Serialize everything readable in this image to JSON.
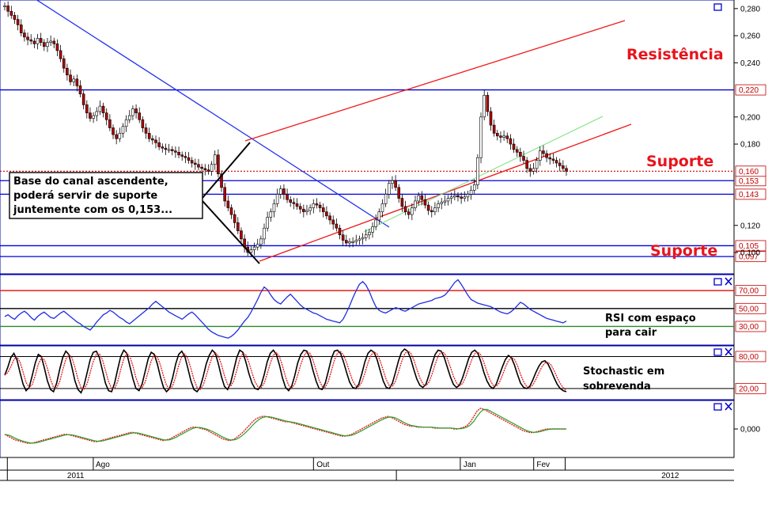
{
  "chart_data": [
    {
      "panel": "price",
      "type": "candlestick",
      "y_ticks": [
        "0,280",
        "0,260",
        "0,240",
        "0,200",
        "0,180",
        "0,120",
        "0,100"
      ],
      "ylim": [
        0.093,
        0.284
      ],
      "support_resistance_levels": [
        {
          "value": 0.22,
          "label": "0,220"
        },
        {
          "value": 0.153,
          "label": "0,153"
        },
        {
          "value": 0.143,
          "label": "0,143"
        },
        {
          "value": 0.105,
          "label": "0,105"
        },
        {
          "value": 0.097,
          "label": "0,097"
        }
      ],
      "last_price": {
        "value": 0.16,
        "label": "0,160"
      },
      "annotations": {
        "resistance": "Resistência",
        "support_1": "Suporte",
        "support_2": "Suporte",
        "note_line1": "Base do canal ascendente,",
        "note_line2": "poderá servir de suporte",
        "note_line3": "juntemente com os 0,153..."
      },
      "close_series": [
        0.282,
        0.278,
        0.275,
        0.272,
        0.268,
        0.262,
        0.259,
        0.257,
        0.256,
        0.254,
        0.258,
        0.255,
        0.252,
        0.255,
        0.256,
        0.254,
        0.249,
        0.243,
        0.236,
        0.231,
        0.226,
        0.228,
        0.223,
        0.217,
        0.209,
        0.203,
        0.199,
        0.201,
        0.204,
        0.208,
        0.203,
        0.198,
        0.192,
        0.187,
        0.184,
        0.188,
        0.193,
        0.198,
        0.201,
        0.206,
        0.203,
        0.198,
        0.192,
        0.188,
        0.184,
        0.183,
        0.181,
        0.178,
        0.177,
        0.176,
        0.176,
        0.175,
        0.174,
        0.172,
        0.171,
        0.17,
        0.168,
        0.166,
        0.165,
        0.163,
        0.162,
        0.161,
        0.16,
        0.165,
        0.172,
        0.158,
        0.148,
        0.138,
        0.133,
        0.128,
        0.122,
        0.116,
        0.11,
        0.104,
        0.1,
        0.102,
        0.104,
        0.106,
        0.11,
        0.118,
        0.126,
        0.13,
        0.136,
        0.143,
        0.147,
        0.143,
        0.139,
        0.137,
        0.136,
        0.134,
        0.132,
        0.13,
        0.131,
        0.133,
        0.136,
        0.135,
        0.133,
        0.13,
        0.127,
        0.124,
        0.121,
        0.118,
        0.113,
        0.109,
        0.107,
        0.108,
        0.108,
        0.109,
        0.11,
        0.111,
        0.113,
        0.115,
        0.119,
        0.124,
        0.13,
        0.136,
        0.143,
        0.151,
        0.153,
        0.148,
        0.14,
        0.134,
        0.13,
        0.128,
        0.133,
        0.138,
        0.142,
        0.139,
        0.135,
        0.131,
        0.13,
        0.133,
        0.136,
        0.137,
        0.138,
        0.14,
        0.141,
        0.142,
        0.141,
        0.14,
        0.141,
        0.143,
        0.146,
        0.15,
        0.17,
        0.2,
        0.216,
        0.204,
        0.194,
        0.188,
        0.186,
        0.185,
        0.186,
        0.184,
        0.18,
        0.176,
        0.174,
        0.171,
        0.168,
        0.162,
        0.16,
        0.162,
        0.168,
        0.175,
        0.173,
        0.17,
        0.169,
        0.168,
        0.166,
        0.164,
        0.162,
        0.16
      ]
    },
    {
      "panel": "rsi",
      "type": "line",
      "y_ticks": [
        "70,00",
        "50,00",
        "30,00"
      ],
      "levels": [
        70,
        50,
        30
      ],
      "ylim": [
        11,
        86
      ],
      "annotation_line1": "RSI com espaço",
      "annotation_line2": "para cair",
      "values": [
        41,
        43,
        40,
        38,
        42,
        45,
        47,
        44,
        40,
        37,
        41,
        44,
        46,
        43,
        40,
        39,
        42,
        45,
        47,
        44,
        41,
        38,
        35,
        33,
        30,
        28,
        26,
        30,
        35,
        39,
        43,
        45,
        48,
        46,
        43,
        40,
        38,
        35,
        33,
        36,
        39,
        42,
        45,
        48,
        51,
        55,
        58,
        55,
        52,
        49,
        46,
        44,
        42,
        40,
        38,
        41,
        44,
        46,
        43,
        39,
        35,
        31,
        27,
        24,
        22,
        20,
        19,
        18,
        17,
        19,
        22,
        26,
        31,
        36,
        40,
        46,
        53,
        60,
        68,
        74,
        71,
        65,
        60,
        57,
        55,
        59,
        63,
        66,
        62,
        58,
        54,
        51,
        49,
        47,
        45,
        44,
        42,
        40,
        38,
        37,
        36,
        35,
        34,
        38,
        45,
        53,
        62,
        70,
        77,
        80,
        76,
        69,
        60,
        52,
        48,
        46,
        45,
        47,
        49,
        51,
        50,
        48,
        47,
        49,
        51,
        53,
        55,
        56,
        57,
        58,
        59,
        61,
        62,
        63,
        65,
        69,
        74,
        79,
        82,
        77,
        71,
        65,
        60,
        58,
        56,
        55,
        54,
        53,
        52,
        50,
        48,
        46,
        45,
        44,
        46,
        49,
        53,
        57,
        55,
        52,
        49,
        47,
        45,
        43,
        41,
        39,
        38,
        37,
        36,
        35,
        34,
        36
      ]
    },
    {
      "panel": "stochastic",
      "type": "line",
      "y_ticks": [
        "80,00",
        "20,00"
      ],
      "levels": [
        80,
        20
      ],
      "ylim": [
        2,
        97
      ],
      "annotation_line1": "Stochastic em",
      "annotation_line2": "sobrevenda",
      "values": [
        45,
        60,
        78,
        86,
        74,
        50,
        28,
        16,
        22,
        44,
        68,
        84,
        80,
        58,
        34,
        18,
        14,
        30,
        56,
        78,
        90,
        84,
        60,
        34,
        18,
        12,
        26,
        50,
        74,
        88,
        90,
        78,
        54,
        30,
        16,
        14,
        30,
        56,
        80,
        92,
        86,
        62,
        38,
        20,
        16,
        28,
        52,
        76,
        88,
        84,
        66,
        42,
        22,
        14,
        20,
        40,
        66,
        84,
        90,
        80,
        58,
        34,
        18,
        14,
        22,
        42,
        66,
        82,
        92,
        86,
        66,
        42,
        24,
        18,
        30,
        54,
        78,
        92,
        88,
        70,
        48,
        30,
        20,
        18,
        26,
        46,
        70,
        86,
        92,
        84,
        64,
        40,
        22,
        16,
        24,
        44,
        68,
        84,
        92,
        90,
        76,
        54,
        34,
        20,
        18,
        30,
        52,
        76,
        90,
        92,
        86,
        70,
        50,
        32,
        22,
        20,
        28,
        48,
        70,
        86,
        92,
        88,
        74,
        54,
        34,
        22,
        20,
        30,
        50,
        72,
        88,
        94,
        90,
        76,
        56,
        38,
        26,
        22,
        28,
        46,
        66,
        84,
        92,
        90,
        78,
        60,
        42,
        28,
        22,
        26,
        40,
        58,
        76,
        88,
        92,
        86,
        70,
        50,
        34,
        24,
        20,
        28,
        44,
        60,
        74,
        82,
        78,
        64,
        46,
        30,
        22,
        20,
        24,
        36,
        50,
        62,
        70,
        72,
        66,
        54,
        40,
        28,
        20,
        16,
        14
      ]
    },
    {
      "panel": "oscillator",
      "type": "line",
      "y_ticks": [
        "0,000"
      ],
      "zero_level": 0,
      "ylim": [
        -0.03,
        0.03
      ],
      "values": [
        -0.006,
        -0.008,
        -0.01,
        -0.012,
        -0.013,
        -0.014,
        -0.015,
        -0.016,
        -0.016,
        -0.015,
        -0.014,
        -0.013,
        -0.012,
        -0.011,
        -0.01,
        -0.009,
        -0.008,
        -0.007,
        -0.006,
        -0.006,
        -0.007,
        -0.008,
        -0.009,
        -0.01,
        -0.011,
        -0.012,
        -0.013,
        -0.014,
        -0.014,
        -0.013,
        -0.012,
        -0.011,
        -0.01,
        -0.009,
        -0.008,
        -0.007,
        -0.006,
        -0.005,
        -0.004,
        -0.004,
        -0.005,
        -0.006,
        -0.007,
        -0.008,
        -0.009,
        -0.01,
        -0.011,
        -0.012,
        -0.013,
        -0.012,
        -0.011,
        -0.009,
        -0.007,
        -0.005,
        -0.003,
        -0.001,
        0.001,
        0.002,
        0.002,
        0.001,
        0.0,
        -0.001,
        -0.003,
        -0.005,
        -0.007,
        -0.009,
        -0.011,
        -0.012,
        -0.013,
        -0.012,
        -0.01,
        -0.007,
        -0.004,
        0.0,
        0.004,
        0.008,
        0.011,
        0.013,
        0.014,
        0.014,
        0.013,
        0.012,
        0.011,
        0.01,
        0.009,
        0.008,
        0.008,
        0.007,
        0.006,
        0.005,
        0.004,
        0.003,
        0.002,
        0.001,
        0.0,
        -0.001,
        -0.002,
        -0.003,
        -0.004,
        -0.005,
        -0.006,
        -0.007,
        -0.008,
        -0.008,
        -0.007,
        -0.006,
        -0.004,
        -0.002,
        0.0,
        0.002,
        0.004,
        0.006,
        0.008,
        0.01,
        0.012,
        0.013,
        0.014,
        0.013,
        0.011,
        0.009,
        0.007,
        0.005,
        0.004,
        0.003,
        0.003,
        0.002,
        0.002,
        0.002,
        0.002,
        0.002,
        0.001,
        0.001,
        0.001,
        0.001,
        0.001,
        0.001,
        0.0,
        0.0,
        0.001,
        0.002,
        0.004,
        0.008,
        0.014,
        0.02,
        0.023,
        0.022,
        0.02,
        0.018,
        0.016,
        0.014,
        0.012,
        0.01,
        0.008,
        0.006,
        0.004,
        0.002,
        0.0,
        -0.002,
        -0.003,
        -0.004,
        -0.004,
        -0.003,
        -0.002,
        -0.001,
        0.0,
        0.0,
        0.0,
        0.0,
        0.0,
        0.0,
        0.0
      ]
    }
  ],
  "x_axis": {
    "months": [
      {
        "label": "Ago",
        "x": 0.14
      },
      {
        "label": "Out",
        "x": 0.44
      },
      {
        "label": "Jan",
        "x": 0.64
      },
      {
        "label": "Fev",
        "x": 0.74
      }
    ],
    "years": [
      {
        "label": "2011",
        "x": 0.06
      },
      {
        "label": "2012",
        "x": 0.87
      }
    ]
  },
  "colors": {
    "candle_up": "#ffffff",
    "candle_down": "#b00000",
    "horizontal_levels": "#0000dd",
    "channel_lines": "#ee1c1c",
    "downtrend_line": "#2233ee",
    "last_price_line": "#cc0000",
    "rsi_line": "#1f2de0",
    "stoch_k": "#000000",
    "stoch_d": "#e41a1c",
    "osc_1": "#e41a1c",
    "osc_2": "#2ca02c"
  },
  "icons": [
    "window-box-icon",
    "close-x-icon"
  ]
}
